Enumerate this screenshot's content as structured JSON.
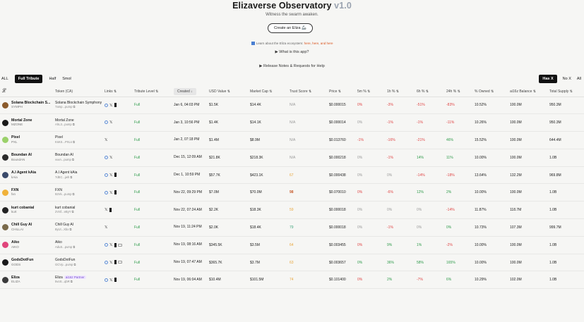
{
  "header": {
    "title": "Elizaverse Observatory",
    "version": "v1.0",
    "subtitle": "Witness the swarm awaken.",
    "create_button": "Create an Eliza 🦾",
    "eco_prefix": "Learn about the Eliza ecosystem:",
    "eco_links": [
      "here",
      "here",
      "and here"
    ],
    "what_is": "▶ What is this app?",
    "release_notes": "▶ Release Notes & Requests for Help"
  },
  "filters": {
    "tiers": [
      "ALL",
      "Full Tribute",
      "Half",
      "Smol"
    ],
    "active_tier": "Full Tribute",
    "right": [
      "Has X",
      "No X",
      "All"
    ],
    "active_right": "Has X"
  },
  "columns": [
    "",
    "Token (CA)",
    "Links ⇅",
    "Tribute Level ⇅",
    "Created ↓",
    "USD Value ⇅",
    "Market Cap ⇅",
    "Trust Score ⇅",
    "Price ⇅",
    "5m % ⇅",
    "1h % ⇅",
    "6h % ⇅",
    "24h % ⇅",
    "% Owned ⇅",
    "ai16z Balance ⇅",
    "Total Supply ⇅"
  ],
  "header_icon": "eliza-logo-icon",
  "rows": [
    {
      "name": "Solana Blockchain S...",
      "symbol": "SYMPH",
      "avatar_color": "#8a5a2b",
      "token_name": "Solana Blockchain Symphony",
      "ca": "7amp...pump",
      "links": [
        "globe",
        "x",
        "telegram"
      ],
      "level": "Full",
      "created": "Jan 6, 04:03 PM",
      "usd": "$1.5K",
      "mcap": "$14.4K",
      "trust": "N/A",
      "trust_class": "na",
      "price": "$0.000015",
      "m5": "0%",
      "m5c": "red",
      "h1": "-3%",
      "h1c": "red",
      "h6": "-51%",
      "h6c": "red",
      "h24": "-83%",
      "h24c": "red",
      "owned": "10.52%",
      "bal": "100.0M",
      "supply": "950.3M"
    },
    {
      "name": "Mortal Zone",
      "symbol": "MZONE",
      "avatar_color": "#1a1a1a",
      "token_name": "Mortal Zone",
      "ca": "AhL3...pump",
      "links": [
        "globe",
        "x"
      ],
      "level": "Full",
      "created": "Jan 3, 10:56 PM",
      "usd": "$1.4K",
      "mcap": "$14.1K",
      "trust": "N/A",
      "trust_class": "na",
      "price": "$0.000014",
      "m5": "0%",
      "m5c": "na",
      "h1": "-1%",
      "h1c": "red",
      "h6": "-1%",
      "h6c": "red",
      "h24": "-11%",
      "h24c": "red",
      "owned": "10.26%",
      "bal": "100.0M",
      "supply": "950.3M"
    },
    {
      "name": "Pixel",
      "symbol": "PXL",
      "avatar_color": "#9bd16a",
      "token_name": "Pixel",
      "ca": "KsKS...PXLs",
      "links": [
        "x"
      ],
      "level": "Full",
      "created": "Jan 2, 07:18 PM",
      "usd": "$1.4M",
      "mcap": "$8.9M",
      "trust": "N/A",
      "trust_class": "na",
      "price": "$0.013760",
      "m5": "-1%",
      "m5c": "red",
      "h1": "-16%",
      "h1c": "red",
      "h6": "-21%",
      "h6c": "red",
      "h24": "46%",
      "h24c": "green",
      "owned": "15.52%",
      "bal": "100.0M",
      "supply": "644.4M"
    },
    {
      "name": "Boundan AI",
      "symbol": "BoundAN",
      "avatar_color": "#2a2a2a",
      "token_name": "Boundan AI",
      "ca": "vuvn...pump",
      "links": [
        "globe",
        "x"
      ],
      "level": "Full",
      "created": "Dec 15, 12:09 AM",
      "usd": "$21.8K",
      "mcap": "$218.3K",
      "trust": "N/A",
      "trust_class": "na",
      "price": "$0.000218",
      "m5": "0%",
      "m5c": "na",
      "h1": "-1%",
      "h1c": "red",
      "h6": "14%",
      "h6c": "green",
      "h24": "11%",
      "h24c": "green",
      "owned": "10.00%",
      "bal": "100.0M",
      "supply": "1.0B"
    },
    {
      "name": "A.I Agent kAia",
      "symbol": "kAia",
      "avatar_color": "#3a4a6a",
      "token_name": "A.I Agent kAia",
      "ca": "7dEC...jwh",
      "links": [
        "globe",
        "x",
        "telegram"
      ],
      "level": "Full",
      "created": "Dec 1, 10:59 PM",
      "usd": "$57.7K",
      "mcap": "$423.1K",
      "trust": "67",
      "trust_class": "orange",
      "price": "$0.000438",
      "m5": "0%",
      "m5c": "na",
      "h1": "0%",
      "h1c": "na",
      "h6": "-14%",
      "h6c": "red",
      "h24": "-18%",
      "h24c": "red",
      "owned": "13.64%",
      "bal": "132.2M",
      "supply": "969.8M"
    },
    {
      "name": "FXN",
      "symbol": "fxn",
      "avatar_color": "#f0b23a",
      "token_name": "FXN",
      "ca": "92Vk...pump",
      "links": [
        "globe",
        "x",
        "telegram"
      ],
      "level": "Full",
      "created": "Nov 22, 09:29 PM",
      "usd": "$7.0M",
      "mcap": "$70.0M",
      "trust": "98",
      "trust_class": "darkorange",
      "price": "$0.070010",
      "m5": "0%",
      "m5c": "red",
      "h1": "-6%",
      "h1c": "red",
      "h6": "12%",
      "h6c": "green",
      "h24": "2%",
      "h24c": "green",
      "owned": "10.00%",
      "bal": "100.0M",
      "supply": "1.0B"
    },
    {
      "name": "kurt cobanial",
      "symbol": "kurt",
      "avatar_color": "#222",
      "token_name": "kurt cobanial",
      "ca": "2VSf...eByY",
      "links": [
        "x",
        "telegram"
      ],
      "level": "Full",
      "created": "Nov 22, 07:24 AM",
      "usd": "$2.2K",
      "mcap": "$18.3K",
      "trust": "59",
      "trust_class": "orange",
      "price": "$0.000018",
      "m5": "0%",
      "m5c": "na",
      "h1": "0%",
      "h1c": "na",
      "h6": "0%",
      "h6c": "na",
      "h24": "-14%",
      "h24c": "red",
      "owned": "11.87%",
      "bal": "118.7M",
      "supply": "1.0B"
    },
    {
      "name": "Chill Guy AI",
      "symbol": "CHILLAI",
      "avatar_color": "#7a6a4a",
      "token_name": "Chill Guy AI",
      "ca": "8yUt...Xbx",
      "links": [
        "x"
      ],
      "level": "Full",
      "created": "Nov 19, 11:24 PM",
      "usd": "$2.0K",
      "mcap": "$18.4K",
      "trust": "79",
      "trust_class": "teal",
      "price": "$0.000018",
      "m5": "0%",
      "m5c": "na",
      "h1": "-1%",
      "h1c": "red",
      "h6": "0%",
      "h6c": "na",
      "h24": "0%",
      "h24c": "green",
      "owned": "10.73%",
      "bal": "107.3M",
      "supply": "999.7M"
    },
    {
      "name": "Aiko",
      "symbol": "AIKO",
      "avatar_color": "#e0457b",
      "token_name": "Aiko",
      "ca": "AduS...pump",
      "links": [
        "globe",
        "x",
        "telegram",
        "discord"
      ],
      "level": "Full",
      "created": "Nov 19, 08:16 AM",
      "usd": "$345.5K",
      "mcap": "$3.5M",
      "trust": "64",
      "trust_class": "orange",
      "price": "$0.003455",
      "m5": "0%",
      "m5c": "red",
      "h1": "9%",
      "h1c": "green",
      "h6": "1%",
      "h6c": "green",
      "h24": "-2%",
      "h24c": "red",
      "owned": "10.00%",
      "bal": "100.0M",
      "supply": "1.0B"
    },
    {
      "name": "GodsDotFun",
      "symbol": "GODS",
      "avatar_color": "#1a1a1a",
      "token_name": "GodsDotFun",
      "ca": "GCVp...pump",
      "links": [
        "globe",
        "x",
        "telegram",
        "discord"
      ],
      "level": "Full",
      "created": "Nov 19, 07:47 AM",
      "usd": "$365.7K",
      "mcap": "$3.7M",
      "trust": "63",
      "trust_class": "orange",
      "price": "$0.003657",
      "m5": "0%",
      "m5c": "green",
      "h1": "36%",
      "h1c": "green",
      "h6": "58%",
      "h6c": "green",
      "h24": "165%",
      "h24c": "green",
      "owned": "10.00%",
      "bal": "100.0M",
      "supply": "1.0B"
    },
    {
      "name": "Eliza",
      "symbol": "ELIZA",
      "avatar_color": "#3a3a3a",
      "token_name": "Eliza",
      "partner": "ai16z Partner",
      "ca": "5voS...qbR",
      "links": [
        "globe",
        "x",
        "telegram"
      ],
      "level": "Full",
      "created": "Nov 19, 06:04 AM",
      "usd": "$10.4M",
      "mcap": "$101.5M",
      "trust": "74",
      "trust_class": "orange",
      "price": "$0.101400",
      "m5": "0%",
      "m5c": "red",
      "h1": "2%",
      "h1c": "green",
      "h6": "-7%",
      "h6c": "red",
      "h24": "6%",
      "h24c": "green",
      "owned": "10.29%",
      "bal": "102.0M",
      "supply": "1.0B"
    }
  ]
}
